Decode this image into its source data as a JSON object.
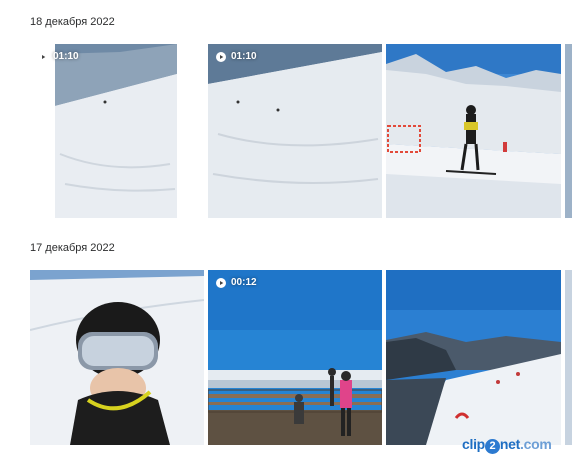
{
  "groups": [
    {
      "date": "18 декабря 2022",
      "items": [
        {
          "kind": "video",
          "duration": "01:10",
          "scene": "ski-slope-video"
        },
        {
          "kind": "video",
          "duration": "01:10",
          "scene": "ski-slope-video"
        },
        {
          "kind": "photo",
          "scene": "skier-on-slope"
        },
        {
          "kind": "photo",
          "scene": "partial"
        }
      ]
    },
    {
      "date": "17 декабря 2022",
      "items": [
        {
          "kind": "photo",
          "scene": "selfie-helmet"
        },
        {
          "kind": "video",
          "duration": "00:12",
          "scene": "viewing-deck"
        },
        {
          "kind": "photo",
          "scene": "mountain-panorama"
        },
        {
          "kind": "photo",
          "scene": "partial"
        }
      ]
    }
  ],
  "watermark": {
    "part1": "clip",
    "part2": "2",
    "part3": "net",
    "part4": ".com"
  },
  "icons": {
    "play": "play-icon"
  },
  "colors": {
    "sky": "#2f86d6",
    "snow": "#e6ebf1",
    "accent": "#e0448a"
  }
}
